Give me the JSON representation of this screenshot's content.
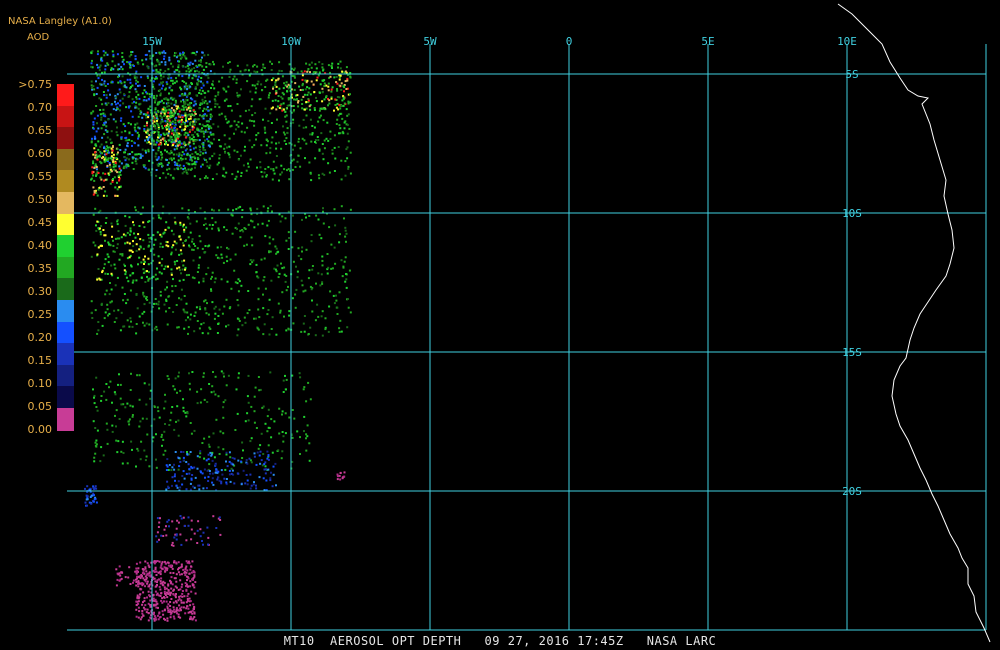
{
  "header": {
    "product_title": "NASA Langley (A1.0)",
    "variable_label": "AOD"
  },
  "legend": {
    "labels": [
      ">0.75",
      "0.70",
      "0.65",
      "0.60",
      "0.55",
      "0.50",
      "0.45",
      "0.40",
      "0.35",
      "0.30",
      "0.25",
      "0.20",
      "0.15",
      "0.10",
      "0.05",
      "0.00"
    ],
    "colors": [
      "#ff1a1a",
      "#c81414",
      "#8e1010",
      "#8a6a1c",
      "#b08a20",
      "#e4b860",
      "#ffff30",
      "#20d030",
      "#22a822",
      "#1a6a1a",
      "#2a8cf0",
      "#1450ff",
      "#1a32b8",
      "#142080",
      "#0a0a4a",
      "#c83c96"
    ]
  },
  "map": {
    "longitude_labels": [
      "15W",
      "10W",
      "5W",
      "0",
      "5E",
      "10E"
    ],
    "latitude_labels": [
      "5S",
      "10S",
      "15S",
      "20S"
    ],
    "grid_color": "#40d0e0",
    "coastline_color": "#ffffff"
  },
  "footer": {
    "caption": "MT10  AEROSOL OPT DEPTH   09 27, 2016 17:45Z   NASA LARC"
  }
}
